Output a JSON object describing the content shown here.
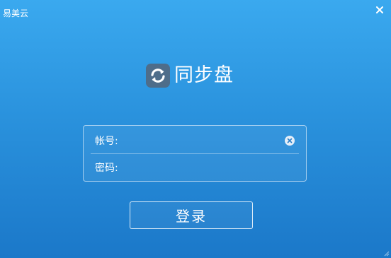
{
  "window": {
    "title": "易美云",
    "close_icon": "close-icon"
  },
  "brand": {
    "logo_icon": "sync-icon",
    "name": "同步盘"
  },
  "form": {
    "account_label": "帐号:",
    "account_value": "",
    "clear_icon": "clear-icon",
    "password_label": "密码:",
    "password_value": ""
  },
  "login_button": {
    "label": "登录"
  },
  "colors": {
    "background_top": "#3aa9ef",
    "background_bottom": "#1b78c9",
    "logo_tile": "#4e6d8a",
    "text": "#ffffff"
  }
}
